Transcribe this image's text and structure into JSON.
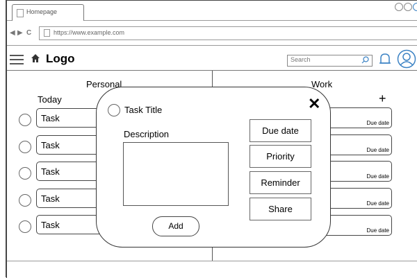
{
  "browser": {
    "tab_label": "Homepage",
    "url": "https://www.example.com"
  },
  "app": {
    "logo": "Logo",
    "search_placeholder": "Search",
    "icons": [
      "menu-icon",
      "home-icon",
      "search-icon",
      "bell-icon",
      "user-icon"
    ]
  },
  "columns": {
    "personal": "Personal",
    "work": "Work"
  },
  "personal": {
    "section": "Today",
    "tasks": [
      "Task",
      "Task",
      "Task",
      "Task",
      "Task"
    ]
  },
  "work": {
    "add": "+",
    "items": [
      "Due date",
      "Due date",
      "Due date",
      "Due date",
      "Due date"
    ]
  },
  "modal": {
    "title": "Task Title",
    "close": "✕",
    "description_label": "Description",
    "add_label": "Add",
    "actions": [
      "Due date",
      "Priority",
      "Reminder",
      "Share"
    ]
  }
}
